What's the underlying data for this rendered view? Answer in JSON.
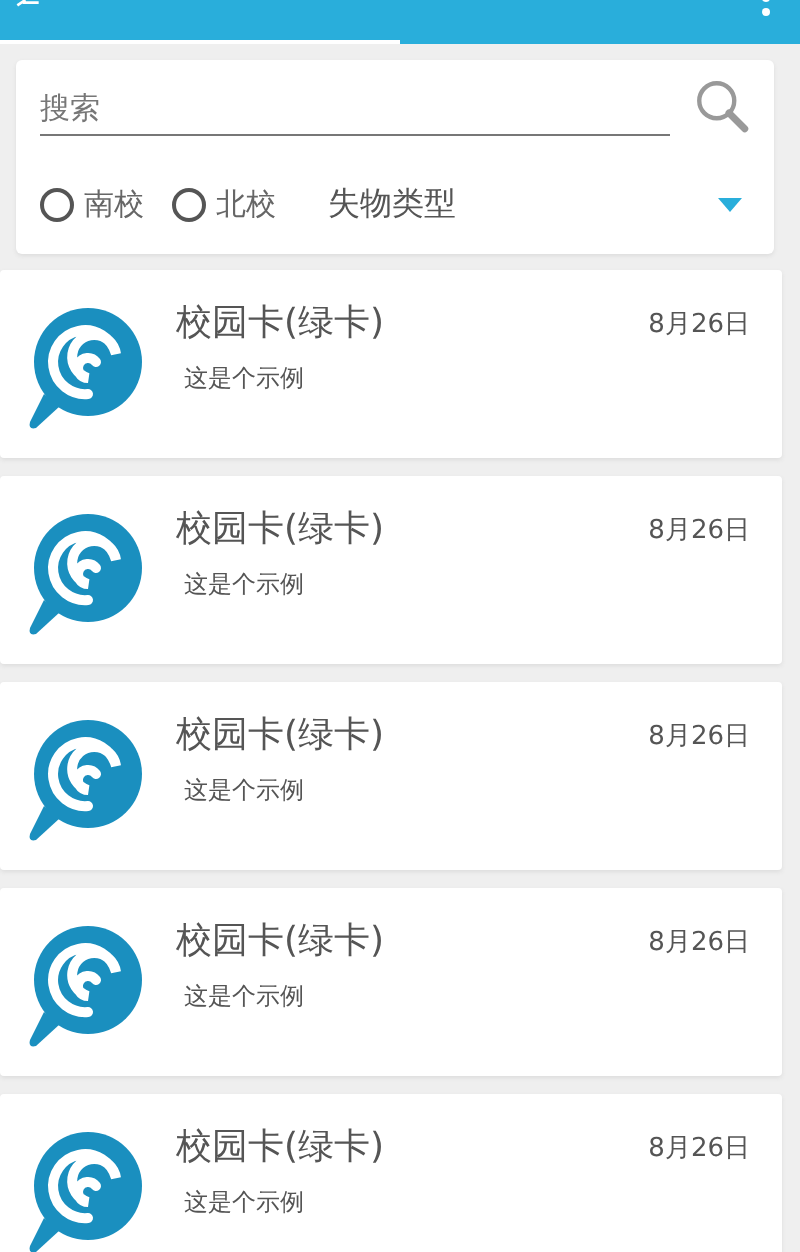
{
  "search": {
    "placeholder": "搜索"
  },
  "campus_options": [
    {
      "label": "南校",
      "selected": false
    },
    {
      "label": "北校",
      "selected": false
    }
  ],
  "category_dropdown": {
    "label": "失物类型"
  },
  "items": [
    {
      "title": "校园卡(绿卡)",
      "description": "这是个示例",
      "date": "8月26日"
    },
    {
      "title": "校园卡(绿卡)",
      "description": "这是个示例",
      "date": "8月26日"
    },
    {
      "title": "校园卡(绿卡)",
      "description": "这是个示例",
      "date": "8月26日"
    },
    {
      "title": "校园卡(绿卡)",
      "description": "这是个示例",
      "date": "8月26日"
    },
    {
      "title": "校园卡(绿卡)",
      "description": "这是个示例",
      "date": "8月26日"
    }
  ]
}
